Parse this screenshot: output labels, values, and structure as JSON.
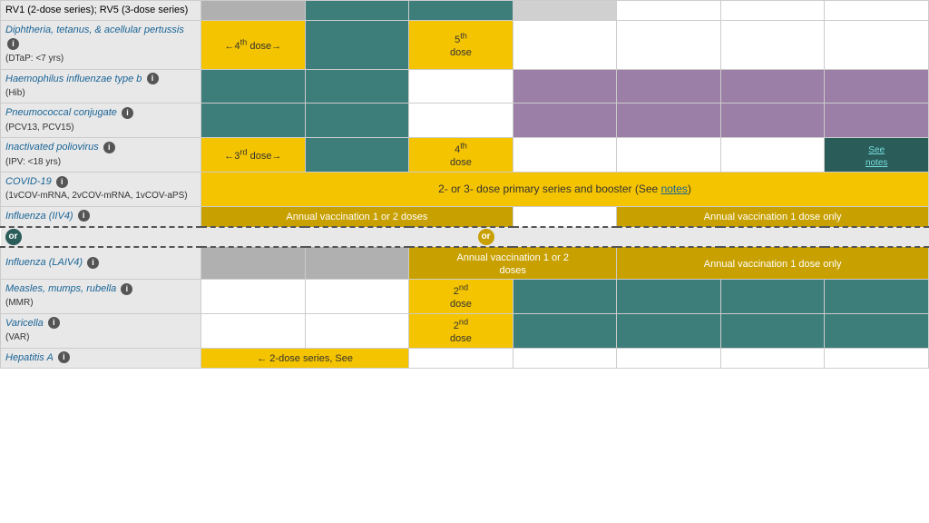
{
  "table": {
    "rows": [
      {
        "id": "rv",
        "name": "RV1 (2-dose series); RV5 (3-dose series)",
        "link": false,
        "subLabel": "",
        "cells": [
          "partial-teal",
          "teal",
          "teal",
          "teal",
          "empty",
          "empty",
          "empty"
        ]
      },
      {
        "id": "dtap",
        "name": "Diphtheria, tetanus, & acellular pertussis",
        "link": true,
        "subLabel": "(DTaP: <7 yrs)",
        "cells": [
          "dose4-arrow",
          "teal",
          "dose5",
          "empty",
          "empty",
          "empty",
          "empty"
        ]
      },
      {
        "id": "hib",
        "name": "Haemophilus influenzae type b",
        "link": true,
        "subLabel": "(Hib)",
        "cells": [
          "teal-full",
          "teal-full",
          "empty",
          "purple",
          "purple",
          "purple",
          "purple"
        ]
      },
      {
        "id": "pcv",
        "name": "Pneumococcal conjugate",
        "link": true,
        "subLabel": "(PCV13, PCV15)",
        "cells": [
          "teal-full",
          "teal-full",
          "empty",
          "purple",
          "purple",
          "purple",
          "purple"
        ]
      },
      {
        "id": "ipv",
        "name": "Inactivated poliovirus",
        "link": true,
        "subLabel": "(IPV: <18 yrs)",
        "cells": [
          "dose3-arrow",
          "teal",
          "dose4",
          "empty",
          "empty",
          "empty",
          "see-notes"
        ]
      },
      {
        "id": "covid",
        "name": "COVID-19",
        "link": true,
        "subLabel": "(1vCOV-mRNA, 2vCOV-mRNA, 1vCOV-aPS)",
        "cells": [
          "covid-span"
        ]
      },
      {
        "id": "influenza-iiv4",
        "name": "Influenza (IIV4)",
        "link": true,
        "subLabel": "",
        "cells": [
          "iiv4-span"
        ]
      },
      {
        "id": "or-row",
        "type": "or",
        "cells": []
      },
      {
        "id": "influenza-laiv4",
        "name": "Influenza (LAIV4)",
        "link": true,
        "subLabel": "",
        "cells": [
          "laiv4-span"
        ]
      },
      {
        "id": "mmr",
        "name": "Measles, mumps, rubella",
        "link": true,
        "subLabel": "(MMR)",
        "cells": [
          "empty",
          "empty",
          "dose2nd",
          "teal",
          "teal",
          "teal",
          "teal"
        ]
      },
      {
        "id": "varicella",
        "name": "Varicella",
        "link": true,
        "subLabel": "(VAR)",
        "cells": [
          "empty",
          "empty",
          "dose2nd-var",
          "teal",
          "teal",
          "teal",
          "teal"
        ]
      },
      {
        "id": "hepa",
        "name": "Hepatitis A",
        "link": true,
        "subLabel": "",
        "cells": [
          "hepa-span"
        ]
      }
    ]
  }
}
